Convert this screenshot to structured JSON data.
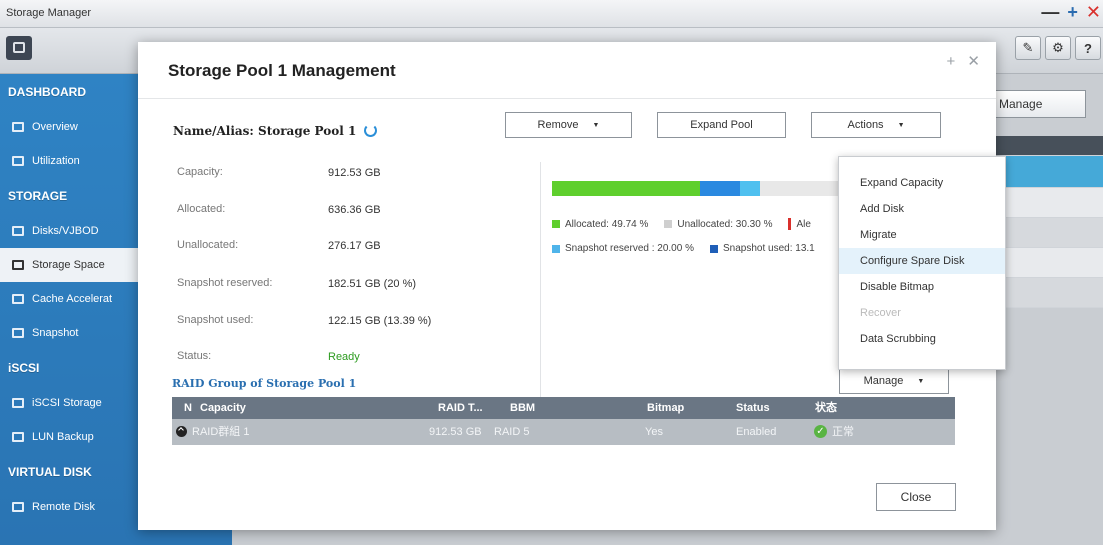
{
  "app": {
    "title": "Storage Manager"
  },
  "window_controls": {
    "minimize": "—",
    "maximize": "+",
    "close": "✕"
  },
  "toolbar": {
    "right_icons": [
      "?"
    ]
  },
  "sidebar": {
    "sections": [
      {
        "title": "DASHBOARD",
        "items": [
          "Overview",
          "Utilization"
        ]
      },
      {
        "title": "STORAGE",
        "items": [
          "Disks/VJBOD",
          "Storage Space",
          "Cache Accelerat",
          "Snapshot"
        ]
      },
      {
        "title": "iSCSI",
        "items": [
          "iSCSI Storage",
          "LUN Backup"
        ]
      },
      {
        "title": "VIRTUAL DISK",
        "items": [
          "Remote Disk"
        ]
      }
    ],
    "active_item": "Storage Space"
  },
  "background_panel": {
    "manage_label": "Manage"
  },
  "modal": {
    "title": "Storage Pool 1 Management",
    "controls": "+ ✕",
    "name_alias": "Name/Alias: Storage Pool 1",
    "buttons": {
      "remove": "Remove",
      "expand_pool": "Expand Pool",
      "actions": "Actions",
      "manage": "Manage",
      "close": "Close"
    },
    "info": [
      {
        "label": "Capacity:",
        "value": "912.53 GB"
      },
      {
        "label": "Allocated:",
        "value": "636.36 GB"
      },
      {
        "label": "Unallocated:",
        "value": "276.17 GB"
      },
      {
        "label": "Snapshot reserved:",
        "value": "182.51 GB (20 %)"
      },
      {
        "label": "Snapshot used:",
        "value": "122.15 GB (13.39 %)"
      },
      {
        "label": "Status:",
        "value": "Ready"
      }
    ],
    "usage_bar": [
      {
        "name": "allocated",
        "fraction": 0.4974,
        "color": "#5fcf2d"
      },
      {
        "name": "snapshot-used",
        "fraction": 0.1339,
        "color": "#2a89e0"
      },
      {
        "name": "snapshot-reserved-free",
        "fraction": 0.0661,
        "color": "#4fc0ef"
      },
      {
        "name": "unallocated",
        "fraction": 0.3026,
        "color": "#e8e8e8"
      }
    ],
    "legend": {
      "allocated": "Allocated: 49.74 %",
      "unallocated": "Unallocated: 30.30 %",
      "alert": "Ale",
      "snapshot_reserved": "Snapshot reserved : 20.00 %",
      "snapshot_used": "Snapshot used: 13.1"
    },
    "legend_colors": {
      "allocated": "#5fcf2d",
      "unallocated": "#cfcfcf",
      "alert": "#d9302c",
      "snapshot_reserved": "#4fb4ea",
      "snapshot_used": "#1f5fb8"
    },
    "raid_group": {
      "title": "RAID Group of Storage Pool 1",
      "columns": [
        "N",
        "Capacity",
        "RAID T...",
        "BBM",
        "Bitmap",
        "Status",
        "状态"
      ],
      "rows": [
        {
          "name": "RAID群組 1",
          "capacity": "912.53 GB",
          "raid_type": "RAID 5",
          "bbm": "",
          "bitmap": "Yes",
          "status": "Enabled",
          "state": "正常"
        }
      ]
    }
  },
  "actions_menu": {
    "items": [
      "Expand Capacity",
      "Add Disk",
      "Migrate",
      "Configure Spare Disk",
      "Disable Bitmap",
      "Recover",
      "Data Scrubbing"
    ],
    "highlighted": "Configure Spare Disk",
    "disabled": [
      "Recover"
    ]
  }
}
